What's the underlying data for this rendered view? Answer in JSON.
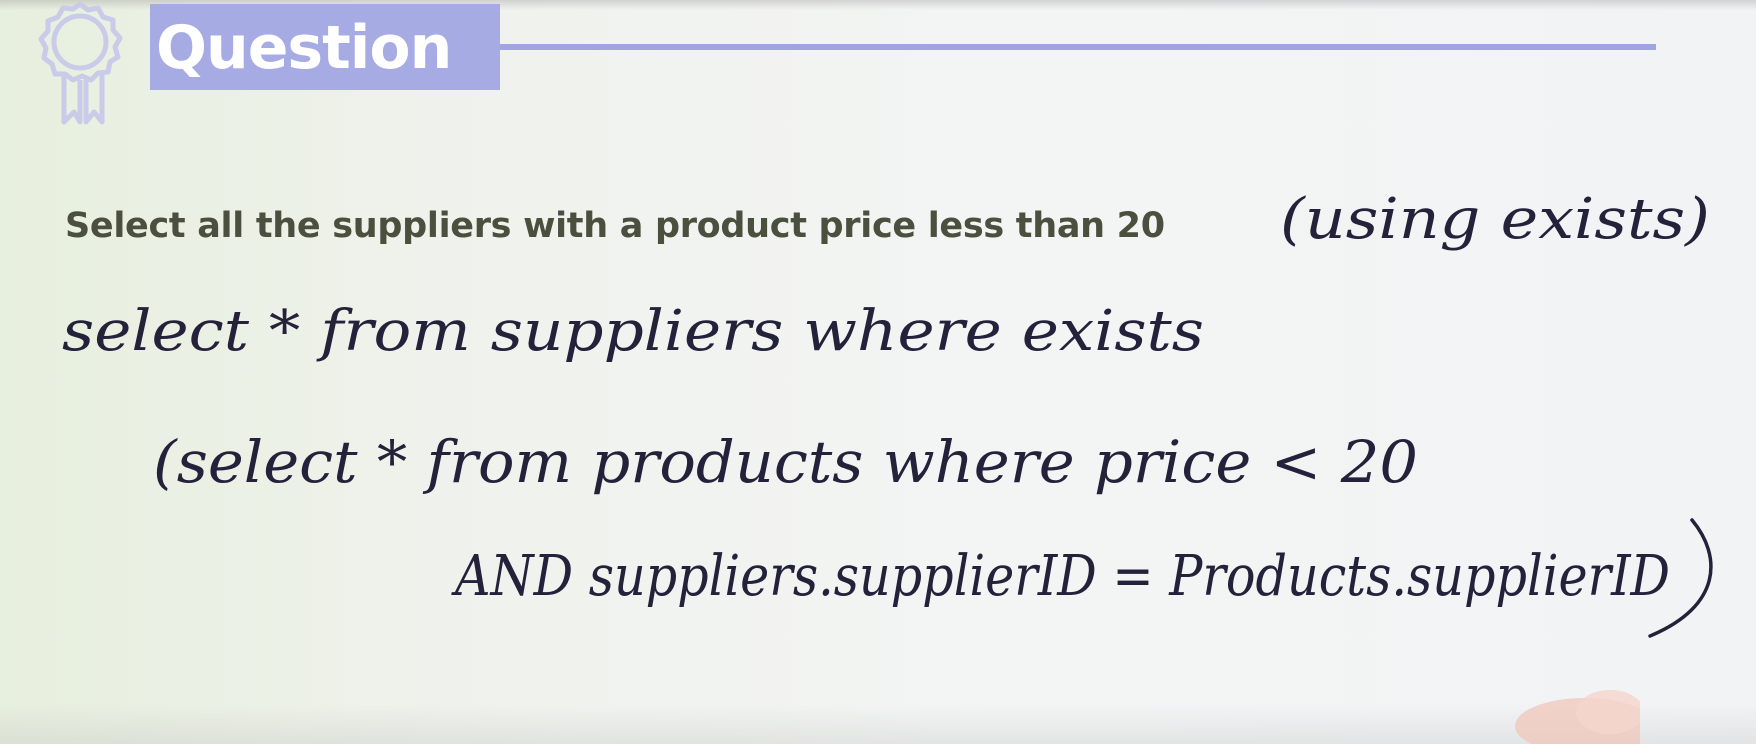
{
  "header": {
    "title": "Question"
  },
  "question": {
    "text": "Select all the suppliers with a product price less than 20"
  },
  "handwriting": {
    "note": "(using exists)",
    "line1": "select * from suppliers where exists",
    "line2": "(select * from products where price < 20",
    "line3": "AND suppliers.supplierID = Products.supplierID"
  },
  "icons": {
    "badge": "award-ribbon-icon"
  },
  "colors": {
    "title_bg": "#a7abe4",
    "title_rule": "#a1a5df",
    "question_text": "#4a4f3e",
    "ink": "#24213a"
  }
}
